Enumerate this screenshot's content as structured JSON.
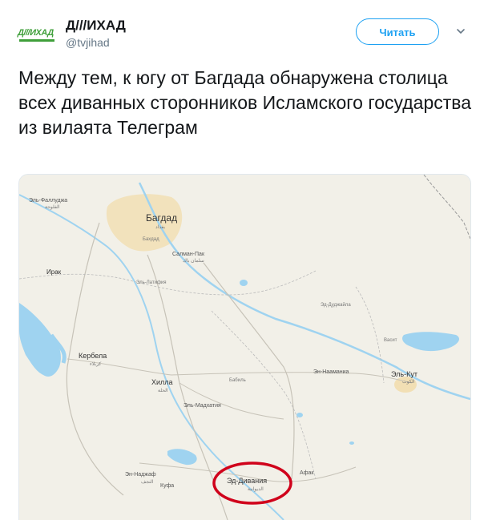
{
  "account": {
    "avatar_text": "Д///ИХАД",
    "display_name": "Д///ИХАД",
    "handle": "@tvjihad"
  },
  "actions": {
    "follow_label": "Читать",
    "more_icon": "chevron-down-icon"
  },
  "tweet": {
    "text": "Между тем, к югу от Багдада обнаружена столица всех диванных сторонников Исламского государства из вилаята Телеграм"
  },
  "map": {
    "labels": {
      "fallujah": "Эль-Фаллуджа",
      "fallujah_ar": "الفلوجة",
      "baghdad": "Багдад",
      "baghdad_ar": "بغداد",
      "baghdad_sub": "Бахдад",
      "salman_pak": "Салман-Пак",
      "salman_pak_ar": "سلمان باك",
      "iraq": "Ирак",
      "latifiya": "Эль-Латифия",
      "karbala": "Кербела",
      "karbala_ar": "كربلاء",
      "hilla": "Хилла",
      "hilla_ar": "الحلة",
      "babil": "Бабиль",
      "mahawil": "Эль-Мадхатия",
      "numaniyah": "Эн-Нааманиа",
      "kut": "Эль-Кут",
      "kut_ar": "الكوت",
      "wasit": "Васит",
      "dujaila": "Эд-Дуджайла",
      "najaf": "Эн-Наджаф",
      "najaf_ar": "النجف",
      "kufa": "Куфа",
      "afak": "Афак",
      "diwaniya": "Эд-Дивания",
      "diwaniya_ar": "الديوانية"
    },
    "highlight_color": "#d0021b"
  }
}
